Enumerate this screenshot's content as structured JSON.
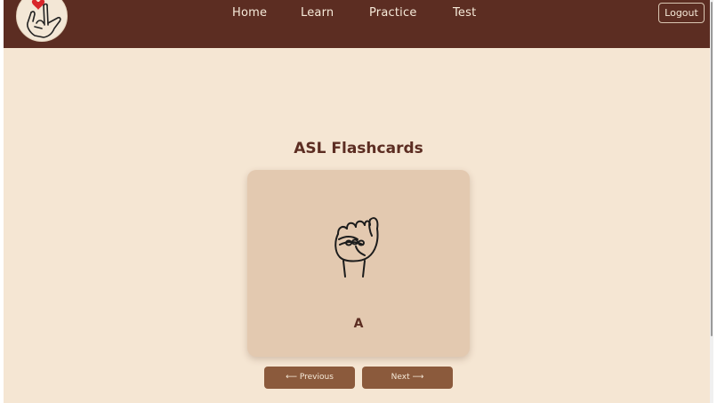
{
  "nav": {
    "links": [
      "Home",
      "Learn",
      "Practice",
      "Test"
    ],
    "logout_label": "Logout"
  },
  "main": {
    "title": "ASL Flashcards"
  },
  "card": {
    "letter": "A"
  },
  "controls": {
    "previous_label": "⟵ Previous",
    "next_label": "Next ⟶"
  },
  "colors": {
    "navbar": "#5c2d22",
    "background": "#f5e6d3",
    "card": "#e3c9b0",
    "button": "#8b5a3c",
    "text_dark": "#5c2d22",
    "text_light": "#f6ead9"
  },
  "icons": {
    "logo": "i-love-you-hand-icon",
    "card_image": "asl-letter-a-hand-icon"
  }
}
